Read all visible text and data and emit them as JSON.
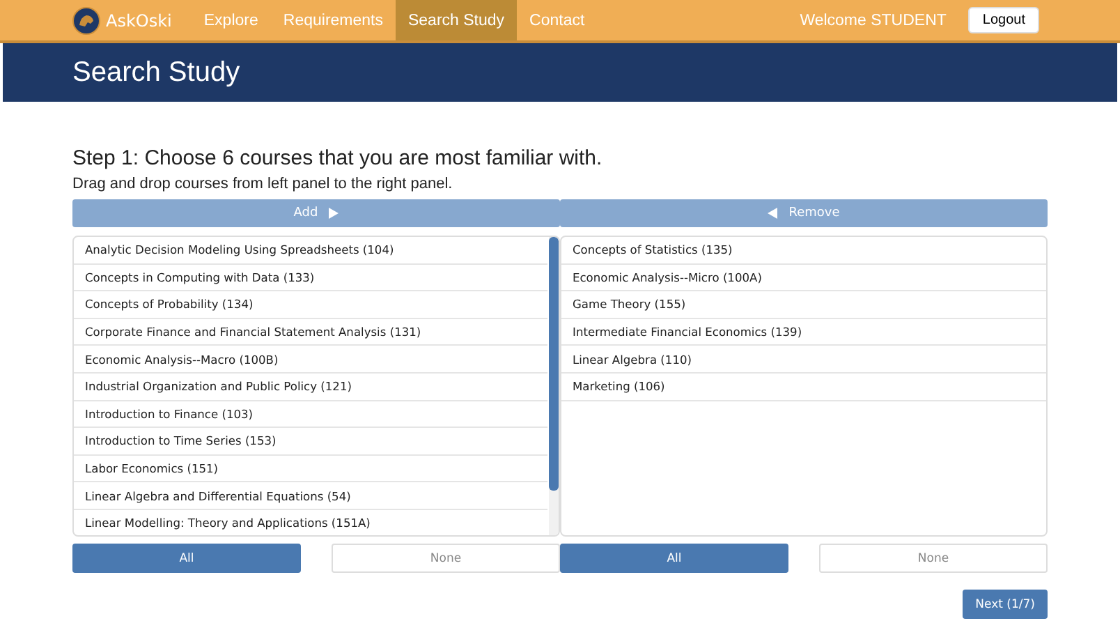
{
  "nav": {
    "brand": "AskOski",
    "items": [
      {
        "label": "Explore",
        "selected": false
      },
      {
        "label": "Requirements",
        "selected": false
      },
      {
        "label": "Search Study",
        "selected": true
      },
      {
        "label": "Contact",
        "selected": false
      }
    ],
    "welcome": "Welcome STUDENT",
    "logout": "Logout"
  },
  "header": {
    "title": "Search Study"
  },
  "step": {
    "title": "Step 1: Choose 6 courses that you are most familiar with.",
    "instruction": "Drag and drop courses from left panel to the right panel."
  },
  "panels": [
    {
      "kind": "add",
      "header": "Add",
      "courses": [
        "Analytic Decision Modeling Using Spreadsheets (104)",
        "Concepts in Computing with Data (133)",
        "Concepts of Probability (134)",
        "Corporate Finance and Financial Statement Analysis (131)",
        "Economic Analysis--Macro (100B)",
        "Industrial Organization and Public Policy (121)",
        "Introduction to Finance (103)",
        "Introduction to Time Series (153)",
        "Labor Economics (151)",
        "Linear Algebra and Differential Equations (54)",
        "Linear Modelling: Theory and Applications (151A)"
      ],
      "scrollable": true,
      "buttons": [
        {
          "label": "All",
          "selected": true
        },
        {
          "label": "None",
          "selected": false
        }
      ]
    },
    {
      "kind": "remove",
      "header": "Remove",
      "courses": [
        "Concepts of Statistics (135)",
        "Economic Analysis--Micro (100A)",
        "Game Theory (155)",
        "Intermediate Financial Economics (139)",
        "Linear Algebra (110)",
        "Marketing (106)"
      ],
      "scrollable": false,
      "buttons": [
        {
          "label": "All",
          "selected": true
        },
        {
          "label": "None",
          "selected": false
        }
      ]
    }
  ],
  "next": "Next (1/7)"
}
